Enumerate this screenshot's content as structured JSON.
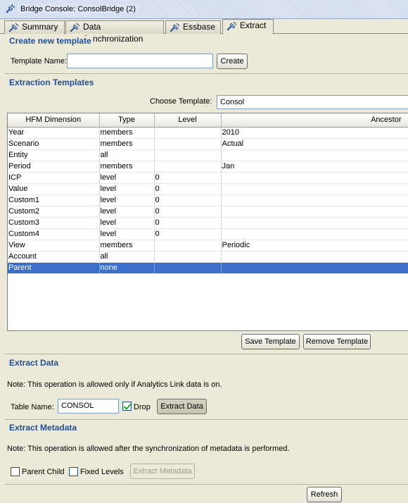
{
  "window": {
    "title": "Bridge Console: ConsolBridge (2)"
  },
  "tabs": [
    {
      "label": "Summary"
    },
    {
      "label": "Data Synchronization"
    },
    {
      "label": "Essbase"
    },
    {
      "label": "Extract"
    }
  ],
  "create_template": {
    "section_title": "Create new template",
    "name_label": "Template Name:",
    "name_value": "",
    "create_button": "Create"
  },
  "extraction_templates": {
    "section_title": "Extraction Templates",
    "choose_label": "Choose Template:",
    "choose_value": "Consol",
    "columns": [
      "HFM Dimension",
      "Type",
      "Level",
      "Ancestor"
    ],
    "rows": [
      {
        "dimension": "Year",
        "type": "members",
        "level": "",
        "ancestor": "2010"
      },
      {
        "dimension": "Scenario",
        "type": "members",
        "level": "",
        "ancestor": "Actual"
      },
      {
        "dimension": "Entity",
        "type": "all",
        "level": "",
        "ancestor": ""
      },
      {
        "dimension": "Period",
        "type": "members",
        "level": "",
        "ancestor": "Jan"
      },
      {
        "dimension": "ICP",
        "type": "level",
        "level": "0",
        "ancestor": ""
      },
      {
        "dimension": "Value",
        "type": "level",
        "level": "0",
        "ancestor": ""
      },
      {
        "dimension": "Custom1",
        "type": "level",
        "level": "0",
        "ancestor": ""
      },
      {
        "dimension": "Custom2",
        "type": "level",
        "level": "0",
        "ancestor": ""
      },
      {
        "dimension": "Custom3",
        "type": "level",
        "level": "0",
        "ancestor": ""
      },
      {
        "dimension": "Custom4",
        "type": "level",
        "level": "0",
        "ancestor": ""
      },
      {
        "dimension": "View",
        "type": "members",
        "level": "",
        "ancestor": "Periodic"
      },
      {
        "dimension": "Account",
        "type": "all",
        "level": "",
        "ancestor": ""
      },
      {
        "dimension": "Parent",
        "type": "none",
        "level": "",
        "ancestor": "",
        "selected": true
      }
    ],
    "save_button": "Save Template",
    "remove_button": "Remove Template"
  },
  "extract_data": {
    "section_title": "Extract Data",
    "note": "Note: This operation is allowed only if Analytics Link data is on.",
    "table_name_label": "Table Name:",
    "table_name_value": "CONSOL",
    "drop_label": "Drop",
    "drop_checked": true,
    "extract_button": "Extract Data"
  },
  "extract_metadata": {
    "section_title": "Extract Metadata",
    "note": "Note: This operation is allowed after the synchronization of metadata is performed.",
    "parent_child_label": "Parent Child",
    "fixed_levels_label": "Fixed Levels",
    "extract_button": "Extract Metadata"
  },
  "refresh_button": "Refresh",
  "colors": {
    "section_title": "#1e4f9c",
    "selection": "#3a6ec9",
    "background": "#ece9d8"
  },
  "icons": {
    "tab_icon": "bridge-plug-icon",
    "window_icon": "bridge-plug-icon"
  }
}
